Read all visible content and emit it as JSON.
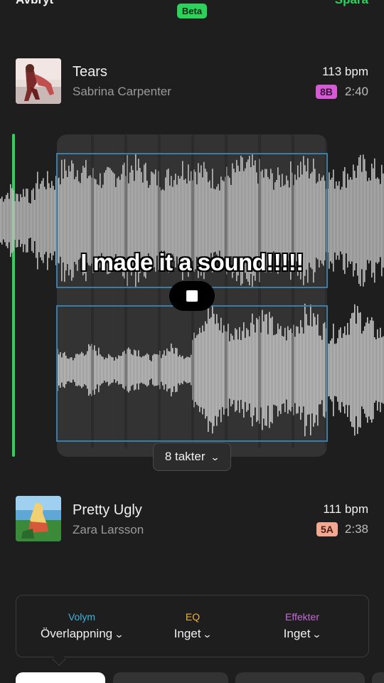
{
  "header": {
    "cancel_label": "Avbryt",
    "save_label": "Spara",
    "beta_badge": "Beta"
  },
  "track_top": {
    "title": "Tears",
    "artist": "Sabrina Carpenter",
    "bpm": "113 bpm",
    "key": "8B",
    "key_color": "#d65ad6",
    "duration": "2:40"
  },
  "track_bottom": {
    "title": "Pretty Ugly",
    "artist": "Zara Larsson",
    "bpm": "111 bpm",
    "key": "5A",
    "key_color": "#f2a891",
    "duration": "2:38"
  },
  "overlay": {
    "caption": "I made it a sound!!!!!"
  },
  "controls": {
    "stop_icon": "stop-icon",
    "bars_label": "8 takter"
  },
  "settings": {
    "volume": {
      "label": "Volym",
      "value": "Överlappning",
      "color": "#3fb3e0"
    },
    "eq": {
      "label": "EQ",
      "value": "Inget",
      "color": "#e8b53a"
    },
    "effects": {
      "label": "Effekter",
      "value": "Inget",
      "color": "#c56ad6"
    }
  },
  "colors": {
    "accent": "#2bd35a",
    "background": "#1e1e1e"
  }
}
